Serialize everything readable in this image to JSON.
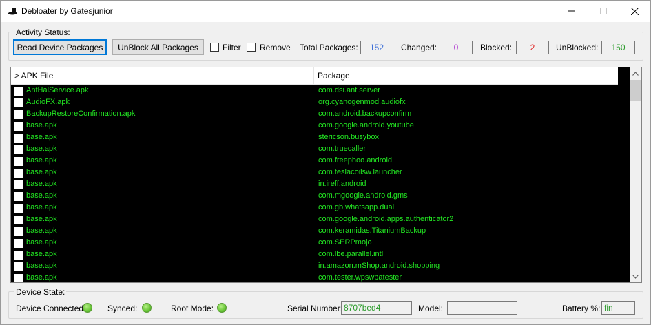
{
  "window": {
    "title": "Debloater by Gatesjunior",
    "icon": "hat-icon",
    "controls": {
      "minimize": "minimize-icon",
      "maximize": "maximize-icon",
      "close": "close-icon"
    }
  },
  "activity": {
    "group_label": "Activity Status:",
    "read_button": "Read Device Packages",
    "unblock_button": "UnBlock All Packages",
    "filter_label": "Filter",
    "remove_label": "Remove",
    "total_label": "Total Packages:",
    "total_value": "152",
    "changed_label": "Changed:",
    "changed_value": "0",
    "blocked_label": "Blocked:",
    "blocked_value": "2",
    "unblocked_label": "UnBlocked:",
    "unblocked_value": "150",
    "colors": {
      "total": "#3d6fd8",
      "changed": "#b03cd0",
      "blocked": "#e02020",
      "unblocked": "#2a9a2a"
    }
  },
  "list": {
    "columns": [
      "> APK File",
      "Package"
    ],
    "text_color": "#22e622",
    "rows": [
      {
        "apk": "AntHalService.apk",
        "pkg": "com.dsi.ant.server"
      },
      {
        "apk": "AudioFX.apk",
        "pkg": "org.cyanogenmod.audiofx"
      },
      {
        "apk": "BackupRestoreConfirmation.apk",
        "pkg": "com.android.backupconfirm"
      },
      {
        "apk": "base.apk",
        "pkg": "com.google.android.youtube"
      },
      {
        "apk": "base.apk",
        "pkg": "stericson.busybox"
      },
      {
        "apk": "base.apk",
        "pkg": "com.truecaller"
      },
      {
        "apk": "base.apk",
        "pkg": "com.freephoo.android"
      },
      {
        "apk": "base.apk",
        "pkg": "com.teslacoilsw.launcher"
      },
      {
        "apk": "base.apk",
        "pkg": "in.ireff.android"
      },
      {
        "apk": "base.apk",
        "pkg": "com.mgoogle.android.gms"
      },
      {
        "apk": "base.apk",
        "pkg": "com.gb.whatsapp.dual"
      },
      {
        "apk": "base.apk",
        "pkg": "com.google.android.apps.authenticator2"
      },
      {
        "apk": "base.apk",
        "pkg": "com.keramidas.TitaniumBackup"
      },
      {
        "apk": "base.apk",
        "pkg": "com.SERPmojo"
      },
      {
        "apk": "base.apk",
        "pkg": "com.lbe.parallel.intl"
      },
      {
        "apk": "base.apk",
        "pkg": "in.amazon.mShop.android.shopping"
      },
      {
        "apk": "base.apk",
        "pkg": "com.tester.wpswpatester"
      }
    ]
  },
  "device": {
    "group_label": "Device State:",
    "connected_label": "Device Connected:",
    "synced_label": "Synced:",
    "root_label": "Root Mode:",
    "serial_label": "Serial Number:",
    "serial_value": "8707bed4",
    "model_label": "Model:",
    "model_value": "",
    "battery_label": "Battery %:",
    "battery_value": "fin",
    "value_color": "#2a9a2a"
  }
}
